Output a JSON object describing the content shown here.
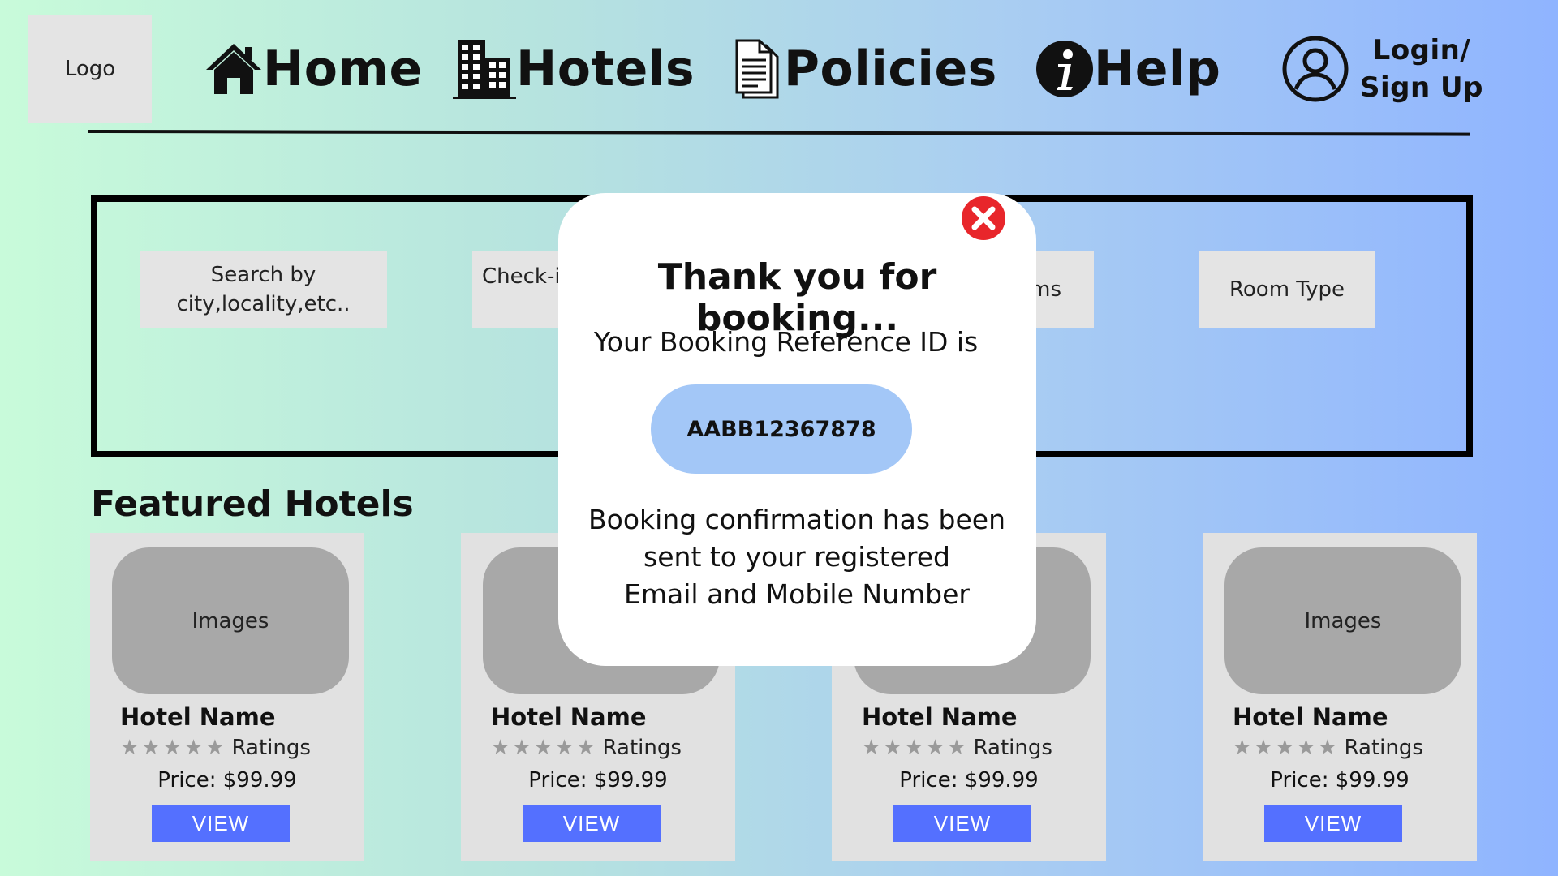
{
  "header": {
    "logo": "Logo",
    "nav": {
      "home": "Home",
      "hotels": "Hotels",
      "policies": "Policies",
      "help": "Help",
      "login": "Login/\nSign Up"
    }
  },
  "search": {
    "location": "Search by\ncity,locality,etc..",
    "checkin": "Check-in",
    "rooms": "Rooms",
    "room_type": "Room Type"
  },
  "featured": {
    "title": "Featured Hotels",
    "hotels": [
      {
        "image": "Images",
        "name": "Hotel Name",
        "rating_label": "Ratings",
        "stars": "★★★★★",
        "price": "Price: $99.99",
        "button": "VIEW"
      },
      {
        "image": "Images",
        "name": "Hotel Name",
        "rating_label": "Ratings",
        "stars": "★★★★★",
        "price": "Price: $99.99",
        "button": "VIEW"
      },
      {
        "image": "Images",
        "name": "Hotel Name",
        "rating_label": "Ratings",
        "stars": "★★★★★",
        "price": "Price: $99.99",
        "button": "VIEW"
      },
      {
        "image": "Images",
        "name": "Hotel Name",
        "rating_label": "Ratings",
        "stars": "★★★★★",
        "price": "Price: $99.99",
        "button": "VIEW"
      }
    ]
  },
  "modal": {
    "title": "Thank you for booking...",
    "subtitle": "Your Booking Reference ID is",
    "reference_id": "AABB12367878",
    "message": "Booking confirmation has been\nsent to  your registered\nEmail and Mobile Number",
    "close_icon": "close-icon"
  },
  "colors": {
    "view_button": "#5470ff",
    "reference_pill": "#a3c7f7",
    "close_icon": "#e8262b",
    "card_bg": "#e1e1e1",
    "image_placeholder": "#a8a8a8"
  }
}
